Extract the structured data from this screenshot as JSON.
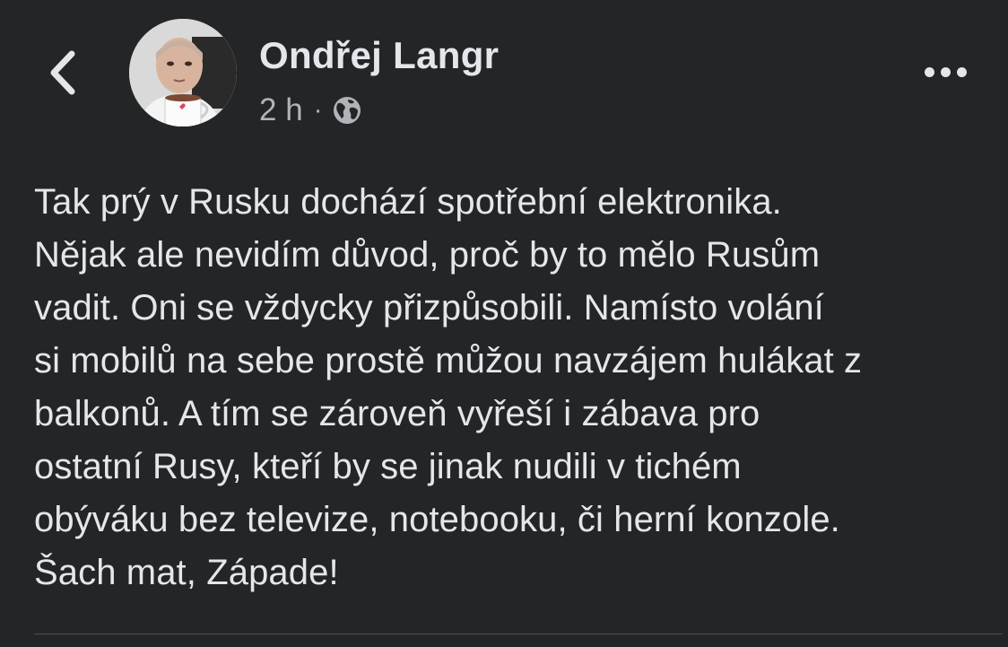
{
  "post": {
    "author": "Ondřej Langr",
    "timestamp": "2 h",
    "separator": "·",
    "audience_icon": "globe-icon",
    "text_lines": [
      "Tak prý v Rusku dochází spotřební elektronika.",
      "Nějak ale nevidím důvod, proč by to mělo Rusům",
      "vadit. Oni se vždycky přizpůsobili. Namísto volání",
      "si mobilů na sebe prostě můžou navzájem hulákat z",
      "balkonů. A tím se zároveň vyřeší i zábava pro",
      "ostatní Rusy, kteří by se jinak nudili v tichém",
      "obýváku bez televize, notebooku, či herní konzole.",
      "Šach mat, Západe!"
    ]
  },
  "toolbar": {
    "back_icon": "chevron-left-icon",
    "more_icon": "more-horizontal-icon"
  },
  "colors": {
    "background": "#242526",
    "primary_text": "#e4e6eb",
    "secondary_text": "#b0b3b8",
    "divider": "#4e4f50"
  }
}
